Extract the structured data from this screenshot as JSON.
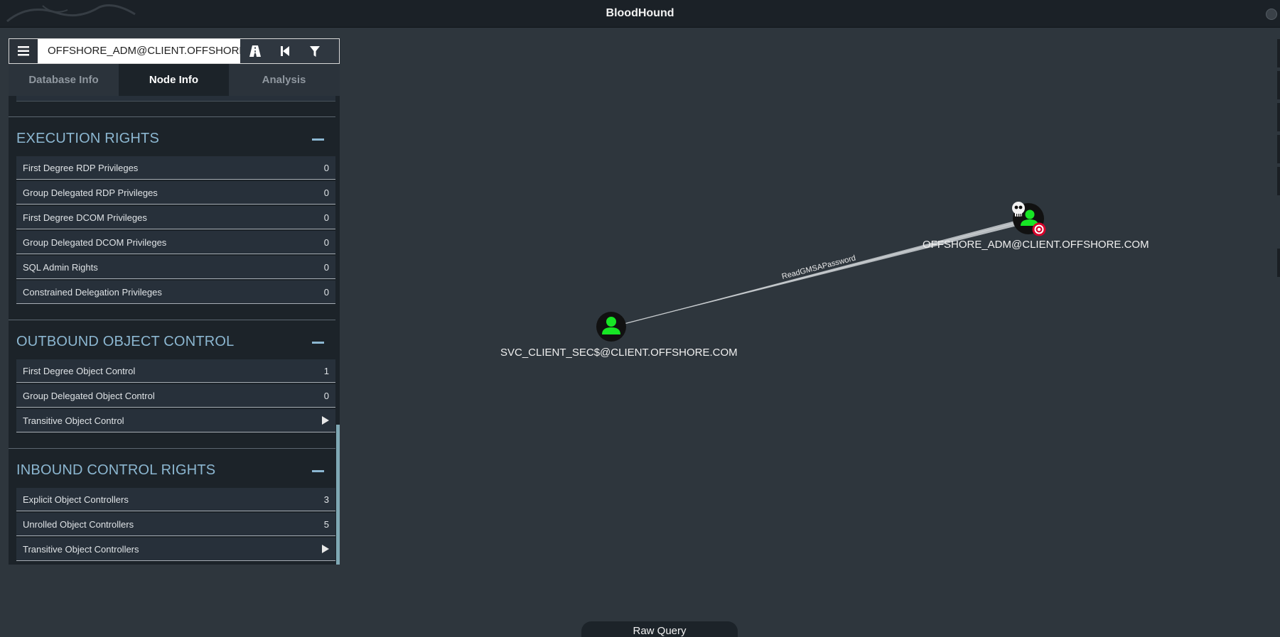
{
  "app": {
    "title": "BloodHound"
  },
  "search": {
    "value": "OFFSHORE_ADM@CLIENT.OFFSHORE.COM"
  },
  "tabs": [
    {
      "label": "Database Info"
    },
    {
      "label": "Node Info"
    },
    {
      "label": "Analysis"
    }
  ],
  "sections": {
    "execution": {
      "title": "EXECUTION RIGHTS",
      "rows": [
        {
          "label": "First Degree RDP Privileges",
          "value": "0"
        },
        {
          "label": "Group Delegated RDP Privileges",
          "value": "0"
        },
        {
          "label": "First Degree DCOM Privileges",
          "value": "0"
        },
        {
          "label": "Group Delegated DCOM Privileges",
          "value": "0"
        },
        {
          "label": "SQL Admin Rights",
          "value": "0"
        },
        {
          "label": "Constrained Delegation Privileges",
          "value": "0"
        }
      ]
    },
    "outbound": {
      "title": "OUTBOUND OBJECT CONTROL",
      "rows": [
        {
          "label": "First Degree Object Control",
          "value": "1"
        },
        {
          "label": "Group Delegated Object Control",
          "value": "0"
        },
        {
          "label": "Transitive Object Control"
        }
      ]
    },
    "inbound": {
      "title": "INBOUND CONTROL RIGHTS",
      "rows": [
        {
          "label": "Explicit Object Controllers",
          "value": "3"
        },
        {
          "label": "Unrolled Object Controllers",
          "value": "5"
        },
        {
          "label": "Transitive Object Controllers"
        }
      ]
    }
  },
  "graph": {
    "nodes": [
      {
        "label": "SVC_CLIENT_SEC$@CLIENT.OFFSHORE.COM"
      },
      {
        "label": "OFFSHORE_ADM@CLIENT.OFFSHORE.COM"
      }
    ],
    "edge_label": "ReadGMSAPassword"
  },
  "footer": {
    "raw_query": "Raw Query"
  },
  "colors": {
    "accent": "#8cb7d1",
    "user_node": "#17e625",
    "target": "#d6002a"
  }
}
